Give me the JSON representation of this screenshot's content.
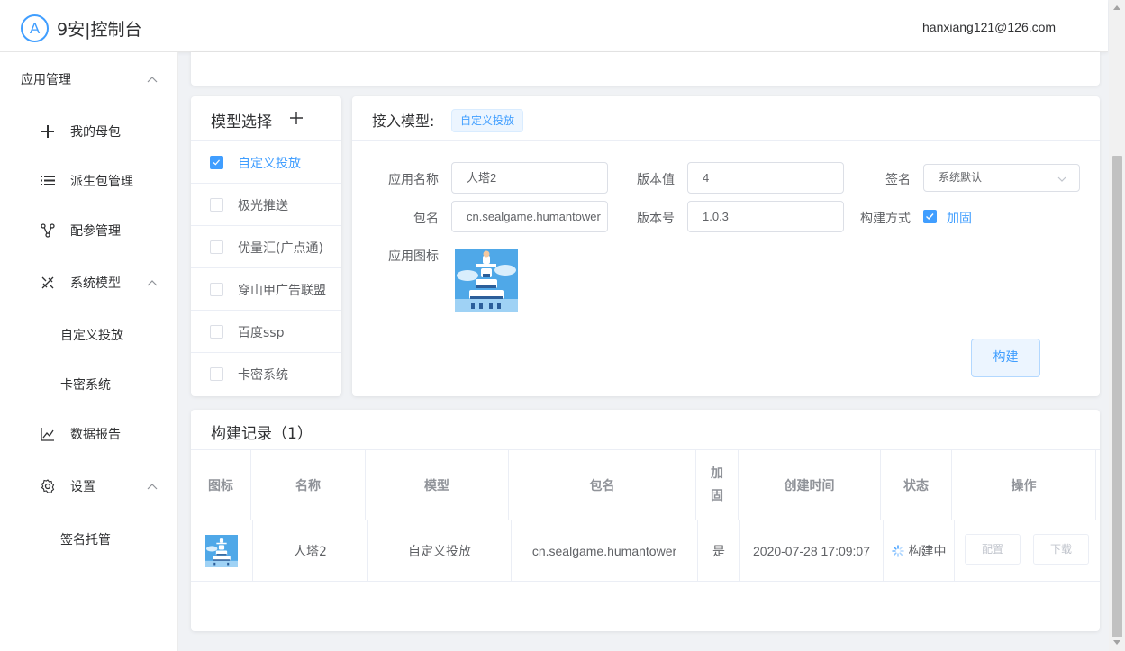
{
  "header": {
    "logo_letter": "A",
    "title": "9安|控制台",
    "user_email": "hanxiang121@126.com"
  },
  "sidebar": {
    "items": [
      {
        "label": "应用管理",
        "icon": "none",
        "expanded": true
      },
      {
        "label": "我的母包",
        "icon": "plus-icon"
      },
      {
        "label": "派生包管理",
        "icon": "list-icon"
      },
      {
        "label": "配参管理",
        "icon": "share-nodes-icon"
      },
      {
        "label": "系统模型",
        "icon": "tools-icon",
        "expanded": true
      },
      {
        "label": "自定义投放",
        "icon": "none"
      },
      {
        "label": "卡密系统",
        "icon": "none"
      },
      {
        "label": "数据报告",
        "icon": "chart-line-icon"
      },
      {
        "label": "设置",
        "icon": "gear-icon",
        "expanded": true
      },
      {
        "label": "签名托管",
        "icon": "none"
      }
    ]
  },
  "model_panel": {
    "title": "模型选择",
    "add_icon": "plus-icon",
    "models": [
      {
        "label": "自定义投放",
        "checked": true
      },
      {
        "label": "极光推送",
        "checked": false
      },
      {
        "label": "优量汇(广点通)",
        "checked": false
      },
      {
        "label": "穿山甲广告联盟",
        "checked": false
      },
      {
        "label": "百度ssp",
        "checked": false
      },
      {
        "label": "卡密系统",
        "checked": false
      }
    ]
  },
  "form": {
    "title": "接入模型:",
    "tag": "自定义投放",
    "app_name_label": "应用名称",
    "app_name_value": "人塔2",
    "version_code_label": "版本值",
    "version_code_value": "4",
    "sign_label": "签名",
    "sign_value": "系统默认",
    "package_label": "包名",
    "package_value": "cn.sealgame.humantower",
    "version_name_label": "版本号",
    "version_name_value": "1.0.3",
    "build_mode_label": "构建方式",
    "build_mode_option": "加固",
    "build_mode_checked": true,
    "icon_label": "应用图标",
    "build_button": "构建"
  },
  "records": {
    "title": "构建记录（1）",
    "columns": [
      "图标",
      "名称",
      "模型",
      "包名",
      "加固",
      "创建时间",
      "状态",
      "操作"
    ],
    "rows": [
      {
        "name": "人塔2",
        "model": "自定义投放",
        "package": "cn.sealgame.humantower",
        "hardened": "是",
        "created": "2020-07-28 17:09:07",
        "status": "构建中",
        "action_config": "配置",
        "action_download": "下载"
      }
    ]
  },
  "colors": {
    "primary": "#409eff",
    "text": "#303133",
    "muted": "#606266",
    "border": "#ebeef5"
  }
}
